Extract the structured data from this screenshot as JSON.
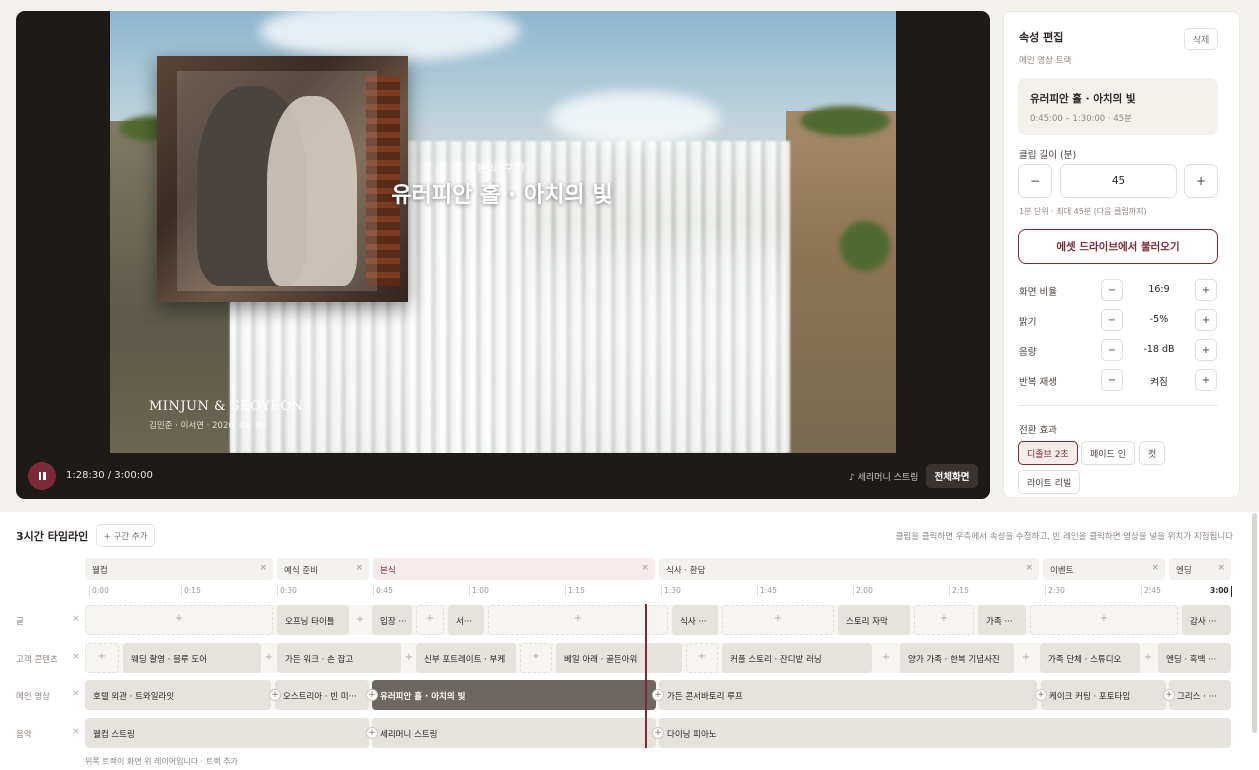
{
  "preview": {
    "overlay_subtitle": "본식 구간",
    "overlay_title": "유러피안 홀 · 아치의 빛",
    "couple_name": "MINJUN & SEOYEON",
    "couple_sub": "김민준 · 이서연 · 2026. 08. 09",
    "time": "1:28:30 / 3:00:00",
    "music": "♪ 세리머니 스트링",
    "fullscreen": "전체화면"
  },
  "panel": {
    "title": "속성 편집",
    "delete": "삭제",
    "track": "메인 영상 트랙",
    "clip_name": "유러피안 홀 · 아치의 빛",
    "clip_range": "0:45:00 – 1:30:00 · 45분",
    "length_label": "클립 길이 (분)",
    "length_minus": "−",
    "length_value": "45",
    "length_plus": "+",
    "length_hint": "1분 단위 · 최대 45분 (다음 클립까지)",
    "asset_button": "에셋 드라이브에서 불러오기",
    "props": [
      {
        "label": "화면 비율",
        "value": "16:9"
      },
      {
        "label": "밝기",
        "value": "-5%"
      },
      {
        "label": "음량",
        "value": "-18 dB"
      },
      {
        "label": "반복 재생",
        "value": "켜짐"
      }
    ],
    "minus": "−",
    "plus": "+",
    "transition_label": "전환 효과",
    "transitions": [
      "디졸브 2초",
      "페이드 인",
      "컷",
      "라이트 리빌"
    ]
  },
  "timeline": {
    "title": "3시간 타임라인",
    "add_section": "+ 구간 추가",
    "hint": "클립을 클릭하면 우측에서 속성을 수정하고, 빈 레인을 클릭하면 영상을 넣을 위치가 지정됩니다",
    "sections": [
      "웰컴",
      "예식 준비",
      "본식",
      "식사 · 환담",
      "이벤트",
      "엔딩"
    ],
    "ticks": [
      "0:00",
      "0:15",
      "0:30",
      "0:45",
      "1:00",
      "1:15",
      "1:30",
      "1:45",
      "2:00",
      "2:15",
      "2:30",
      "2:45",
      "3:00"
    ],
    "lanes": [
      "글",
      "고객 콘텐츠",
      "메인 영상",
      "음악"
    ],
    "text_clips": [
      "오프닝 타이틀",
      "입장 ···",
      "서···",
      "식사 ···",
      "스토리 자막",
      "가족 ···",
      "감사 ···"
    ],
    "customer_clips": [
      "웨딩 촬영 · 블루 도어",
      "가든 워크 · 손 잡고",
      "신부 포트레이트 · 부케",
      "베일 아래 · 골든아워",
      "커플 스토리 · 잔디밭 러닝",
      "양가 가족 · 한복 기념사진",
      "가족 단체 · 스튜디오",
      "엔딩 · 흑백 ···"
    ],
    "main_clips": [
      "호텔 외관 · 트와일라잇",
      "오스트리아 · 빈 미···",
      "유러피안 홀 · 아치의 빛",
      "가든 콘서바토리 루프",
      "케이크 커팅 · 포토타임",
      "그리스 · ···"
    ],
    "music_clips": [
      "웰컴 스트링",
      "세리머니 스트링",
      "다이닝 피아노"
    ],
    "add": "+",
    "remove": "×",
    "footer": "위쪽 트랙이 화면 위 레이어입니다 · 트랙 추가"
  },
  "colors": {
    "accent": "#7c2a35",
    "selected_clip": "#6e6661",
    "clip": "#e6e2de"
  }
}
